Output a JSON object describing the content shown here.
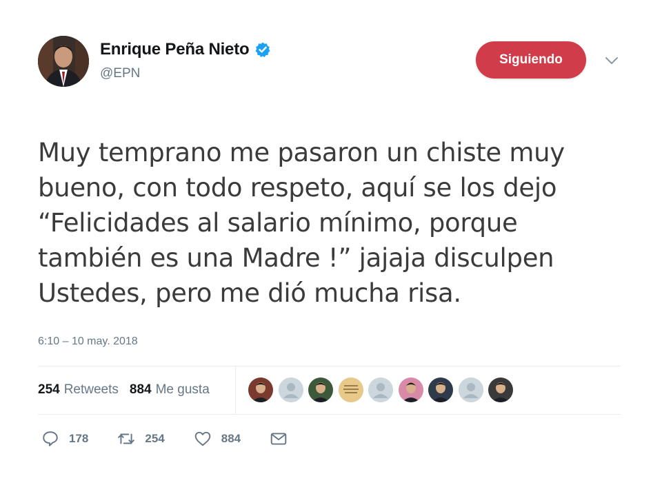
{
  "user": {
    "display_name": "Enrique Peña Nieto",
    "handle": "@EPN",
    "verified": true
  },
  "follow_button_label": "Siguiendo",
  "colors": {
    "follow_button": "#d13c4a",
    "verified_badge": "#1da1f2",
    "secondary_text": "#657786"
  },
  "tweet": {
    "lines": [
      "Muy temprano me pasaron un chiste muy",
      "bueno, con todo respeto, aquí se los dejo",
      "“Felicidades al salario mínimo, porque",
      "también es una Madre !” jajaja disculpen",
      "Ustedes, pero me dió mucha risa."
    ],
    "timestamp": "6:10 – 10 may. 2018"
  },
  "stats": {
    "retweets_count": "254",
    "retweets_label": "Retweets",
    "likes_count": "884",
    "likes_label": "Me gusta"
  },
  "likers": [
    {
      "type": "photo",
      "color": "#7a3b2e"
    },
    {
      "type": "default",
      "color": "#aab8c2"
    },
    {
      "type": "photo",
      "color": "#3c5a3a"
    },
    {
      "type": "badge",
      "color": "#e8c98a"
    },
    {
      "type": "default",
      "color": "#aab8c2"
    },
    {
      "type": "photo",
      "color": "#d98aa8"
    },
    {
      "type": "photo",
      "color": "#2f3b4a"
    },
    {
      "type": "default",
      "color": "#aab8c2"
    },
    {
      "type": "photo",
      "color": "#3a3a3a"
    }
  ],
  "actions": {
    "replies": "178",
    "retweets": "254",
    "likes": "884",
    "icons": [
      "reply-icon",
      "retweet-icon",
      "like-icon",
      "message-icon"
    ]
  }
}
